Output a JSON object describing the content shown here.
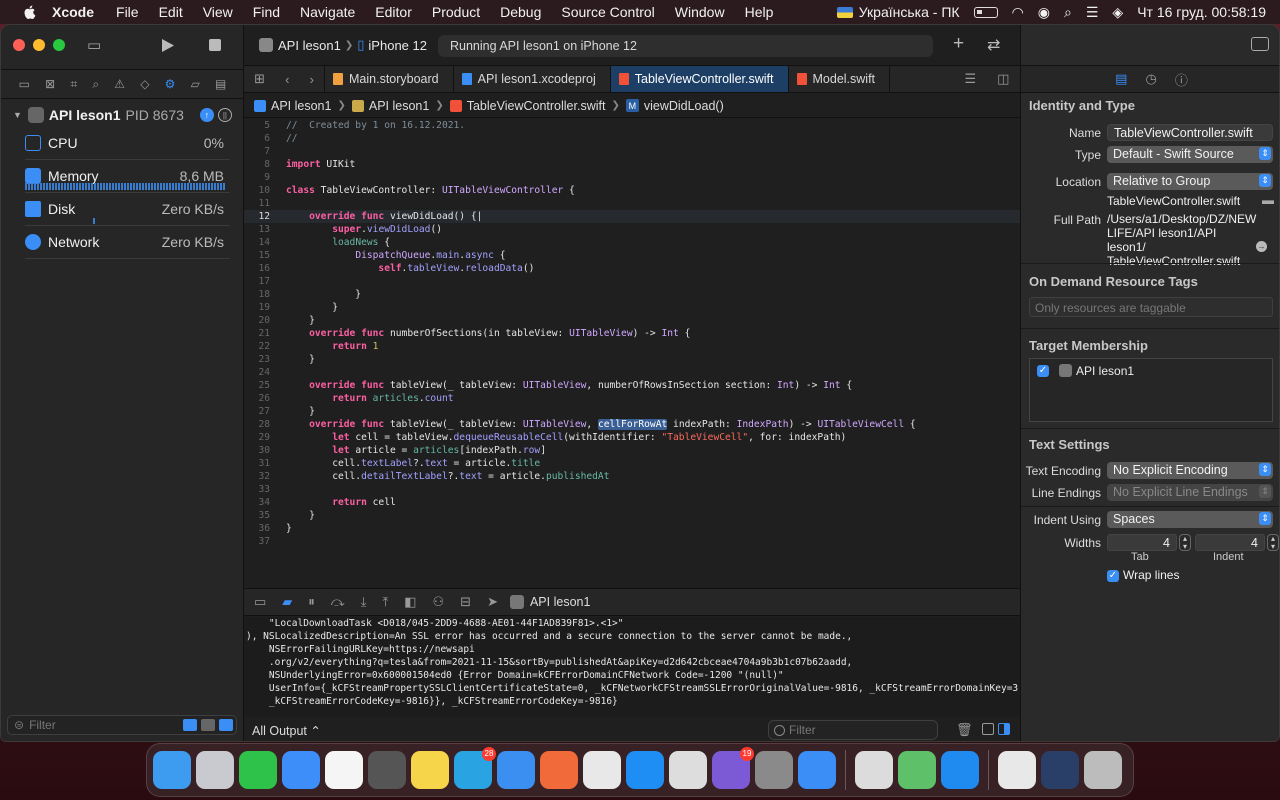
{
  "menubar": {
    "app": "Xcode",
    "items": [
      "File",
      "Edit",
      "View",
      "Find",
      "Navigate",
      "Editor",
      "Product",
      "Debug",
      "Source Control",
      "Window",
      "Help"
    ],
    "input_source": "Українська - ПК",
    "clock": "Чт 16 груд.  00:58:19"
  },
  "toolbar": {
    "scheme_name": "API leson1",
    "device": "iPhone 12",
    "status": "Running API leson1 on iPhone 12"
  },
  "debug_navigator": {
    "process_name": "API leson1",
    "pid": "PID 8673",
    "gauges": [
      {
        "name": "CPU",
        "value": "0%"
      },
      {
        "name": "Memory",
        "value": "8,6 MB"
      },
      {
        "name": "Disk",
        "value": "Zero KB/s"
      },
      {
        "name": "Network",
        "value": "Zero KB/s"
      }
    ],
    "filter_placeholder": "Filter"
  },
  "tabs": [
    {
      "label": "Main.storyboard",
      "color": "#f0a040"
    },
    {
      "label": "API leson1.xcodeproj",
      "color": "#3a8ef6"
    },
    {
      "label": "TableViewController.swift",
      "color": "#f05138",
      "active": true
    },
    {
      "label": "Model.swift",
      "color": "#f05138"
    }
  ],
  "jumpbar": {
    "project": "API leson1",
    "group": "API leson1",
    "file": "TableViewController.swift",
    "symbol": "viewDidLoad()"
  },
  "code_lines": [
    {
      "n": "5",
      "html": "<span class='cm'>//  Created by 1 on 16.12.2021.</span>"
    },
    {
      "n": "6",
      "html": "<span class='cm'>//</span>"
    },
    {
      "n": "7",
      "html": ""
    },
    {
      "n": "8",
      "html": "<span class='kw'>import</span> UIKit"
    },
    {
      "n": "9",
      "html": ""
    },
    {
      "n": "10",
      "html": "<span class='kw'>class</span> TableViewController: <span class='ty'>UITableViewController</span> {"
    },
    {
      "n": "11",
      "html": ""
    },
    {
      "n": "12",
      "html": "    <span class='kw'>override</span> <span class='kw'>func</span> viewDidLoad() {|",
      "current": true
    },
    {
      "n": "13",
      "html": "        <span class='kw'>super</span>.<span class='fn'>viewDidLoad</span>()"
    },
    {
      "n": "14",
      "html": "        <span class='mt'>loadNews</span> {"
    },
    {
      "n": "15",
      "html": "            <span class='ty'>DispatchQueue</span>.<span class='fn'>main</span>.<span class='fn'>async</span> {"
    },
    {
      "n": "16",
      "html": "                <span class='kw'>self</span>.<span class='fn'>tableView</span>.<span class='fn'>reloadData</span>()"
    },
    {
      "n": "17",
      "html": ""
    },
    {
      "n": "18",
      "html": "            }"
    },
    {
      "n": "19",
      "html": "        }"
    },
    {
      "n": "20",
      "html": "    }"
    },
    {
      "n": "21",
      "html": "    <span class='kw'>override</span> <span class='kw'>func</span> numberOfSections(in tableView: <span class='ty'>UITableView</span>) -> <span class='ty'>Int</span> {"
    },
    {
      "n": "22",
      "html": "        <span class='kw'>return</span> <span class='num'>1</span>"
    },
    {
      "n": "23",
      "html": "    }"
    },
    {
      "n": "24",
      "html": ""
    },
    {
      "n": "25",
      "html": "    <span class='kw'>override</span> <span class='kw'>func</span> tableView(_ tableView: <span class='ty'>UITableView</span>, numberOfRowsInSection section: <span class='ty'>Int</span>) -> <span class='ty'>Int</span> {"
    },
    {
      "n": "26",
      "html": "        <span class='kw'>return</span> <span class='mt'>articles</span>.<span class='fn'>count</span>"
    },
    {
      "n": "27",
      "html": "    }"
    },
    {
      "n": "28",
      "html": "    <span class='kw'>override</span> <span class='kw'>func</span> tableView(_ tableView: <span class='ty'>UITableView</span>, <span class='hl'>cellForRowAt</span> indexPath: <span class='ty'>IndexPath</span>) -> <span class='ty'>UITableViewCell</span> {"
    },
    {
      "n": "29",
      "html": "        <span class='kw'>let</span> cell = tableView.<span class='fn'>dequeueReusableCell</span>(withIdentifier: <span class='str'>\"TableViewCell\"</span>, for: indexPath)"
    },
    {
      "n": "30",
      "html": "        <span class='kw'>let</span> article = <span class='mt'>articles</span>[indexPath.<span class='fn'>row</span>]"
    },
    {
      "n": "31",
      "html": "        cell.<span class='fn'>textLabel</span>?.<span class='fn'>text</span> = article.<span class='mt'>title</span>"
    },
    {
      "n": "32",
      "html": "        cell.<span class='fn'>detailTextLabel</span>?.<span class='fn'>text</span> = article.<span class='mt'>publishedAt</span>"
    },
    {
      "n": "33",
      "html": ""
    },
    {
      "n": "34",
      "html": "        <span class='kw'>return</span> cell"
    },
    {
      "n": "35",
      "html": "    }"
    },
    {
      "n": "36",
      "html": "}"
    },
    {
      "n": "37",
      "html": ""
    }
  ],
  "debug_bar": {
    "target": "API leson1"
  },
  "console": {
    "lines": [
      "    \"LocalDownloadTask <D018/045-2DD9-4688-AE01-44F1AD839F81>.<1>\"",
      "), NSLocalizedDescription=An SSL error has occurred and a secure connection to the server cannot be made.,",
      "    NSErrorFailingURLKey=https://newsapi",
      "    .org/v2/everything?q=tesla&from=2021-11-15&sortBy=publishedAt&apiKey=d2d642cbceae4704a9b3b1c07b62aadd,",
      "    NSUnderlyingError=0x600001504ed0 {Error Domain=kCFErrorDomainCFNetwork Code=-1200 \"(null)\"",
      "    UserInfo={_kCFStreamPropertySSLClientCertificateState=0, _kCFNetworkCFStreamSSLErrorOriginalValue=-9816, _kCFStreamErrorDomainKey=3,",
      "    _kCFStreamErrorCodeKey=-9816}}, _kCFStreamErrorCodeKey=-9816}"
    ],
    "output_selector": "All Output ⌃",
    "filter_placeholder": "Filter"
  },
  "inspector": {
    "identity_title": "Identity and Type",
    "name_label": "Name",
    "name_value": "TableViewController.swift",
    "type_label": "Type",
    "type_value": "Default - Swift Source",
    "location_label": "Location",
    "location_value": "Relative to Group",
    "location_file": "TableViewController.swift",
    "full_path_label": "Full Path",
    "full_path_value": "/Users/a1/Desktop/DZ/NEW LIFE/API leson1/API leson1/ TableViewController.swift",
    "odr_title": "On Demand Resource Tags",
    "odr_placeholder": "Only resources are taggable",
    "target_title": "Target Membership",
    "target_name": "API leson1",
    "text_title": "Text Settings",
    "encoding_label": "Text Encoding",
    "encoding_value": "No Explicit Encoding",
    "line_endings_label": "Line Endings",
    "line_endings_value": "No Explicit Line Endings",
    "indent_label": "Indent Using",
    "indent_value": "Spaces",
    "widths_label": "Widths",
    "tab_width": "4",
    "indent_width": "4",
    "tab_sublabel": "Tab",
    "indent_sublabel": "Indent",
    "wrap_label": "Wrap lines"
  },
  "dock": {
    "apps": [
      {
        "name": "finder-icon",
        "color": "#3d9bf0"
      },
      {
        "name": "launchpad-icon",
        "color": "#c9c9d0"
      },
      {
        "name": "facetime-icon",
        "color": "#2fc24a"
      },
      {
        "name": "mail-icon",
        "color": "#3d8ef8"
      },
      {
        "name": "photos-icon",
        "color": "#f5f5f5"
      },
      {
        "name": "calculator-icon",
        "color": "#555555"
      },
      {
        "name": "notes-icon",
        "color": "#f7d54a"
      },
      {
        "name": "telegram-icon",
        "color": "#2aa3e2",
        "badge": "28"
      },
      {
        "name": "safari-icon",
        "color": "#3b8ff0"
      },
      {
        "name": "swift-playgrounds-icon",
        "color": "#f06a3a"
      },
      {
        "name": "chrome-icon",
        "color": "#e8e8e8"
      },
      {
        "name": "app-store-icon",
        "color": "#1e8ef5"
      },
      {
        "name": "simulator-icon",
        "color": "#dddddd"
      },
      {
        "name": "viber-icon",
        "color": "#7c5ad6",
        "badge": "19"
      },
      {
        "name": "system-preferences-icon",
        "color": "#8a8a8a"
      },
      {
        "name": "instruments-icon",
        "color": "#3a8ef6"
      }
    ],
    "recent": [
      {
        "name": "preview-icon",
        "color": "#dcdcdc"
      },
      {
        "name": "maps-icon",
        "color": "#5fc06a"
      },
      {
        "name": "xcode-icon",
        "color": "#1f8af0"
      }
    ],
    "stacks": [
      {
        "name": "downloads-stack-icon",
        "color": "#e8e8e8"
      },
      {
        "name": "screenshots-stack-icon",
        "color": "#2a3f68"
      },
      {
        "name": "trash-icon",
        "color": "#bcbcbc"
      }
    ]
  }
}
